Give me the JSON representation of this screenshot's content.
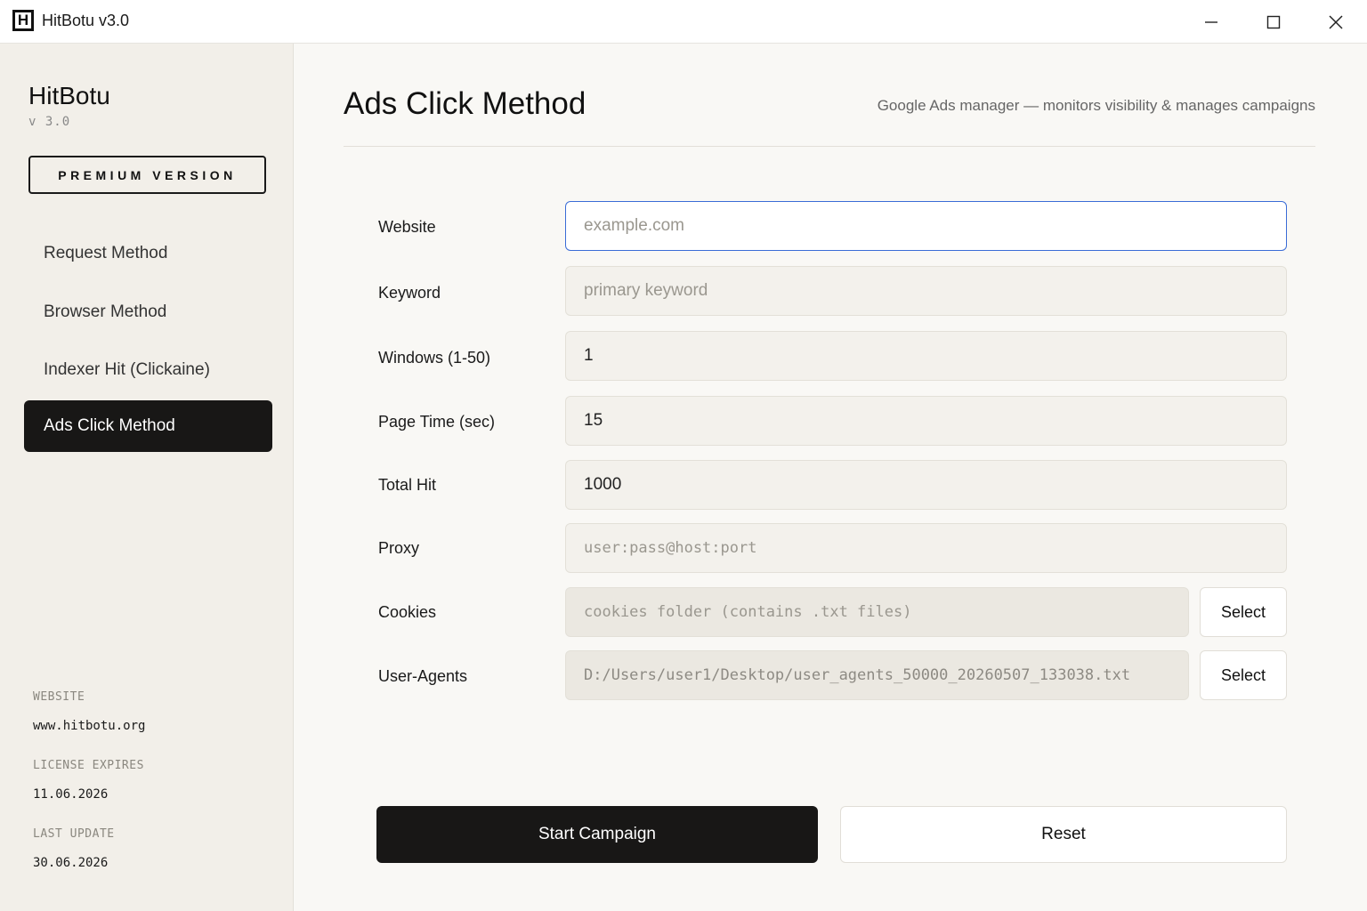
{
  "window": {
    "title": "HitBotu v3.0",
    "icon_letter": "H"
  },
  "sidebar": {
    "brand": "HitBotu",
    "version": "v 3.0",
    "premium_label": "PREMIUM VERSION",
    "items": [
      {
        "label": "Request Method",
        "active": false
      },
      {
        "label": "Browser Method",
        "active": false
      },
      {
        "label": "Indexer Hit (Clickaine)",
        "active": false
      },
      {
        "label": "Ads Click Method",
        "active": true
      }
    ],
    "meta": {
      "website_label": "WEBSITE",
      "website_value": "www.hitbotu.org",
      "license_label": "LICENSE EXPIRES",
      "license_value": "11.06.2026",
      "update_label": "LAST UPDATE",
      "update_value": "30.06.2026"
    }
  },
  "main": {
    "title": "Ads Click Method",
    "subtitle": "Google Ads manager — monitors visibility & manages campaigns",
    "fields": {
      "website": {
        "label": "Website",
        "value": "",
        "placeholder": "example.com"
      },
      "keyword": {
        "label": "Keyword",
        "value": "",
        "placeholder": "primary keyword"
      },
      "windows": {
        "label": "Windows (1-50)",
        "value": "1",
        "placeholder": ""
      },
      "page_time": {
        "label": "Page Time (sec)",
        "value": "15",
        "placeholder": ""
      },
      "total_hit": {
        "label": "Total Hit",
        "value": "1000",
        "placeholder": ""
      },
      "proxy": {
        "label": "Proxy",
        "value": "",
        "placeholder": "user:pass@host:port"
      },
      "cookies": {
        "label": "Cookies",
        "value": "",
        "placeholder": "cookies folder (contains .txt files)",
        "button": "Select"
      },
      "user_agents": {
        "label": "User-Agents",
        "value": "D:/Users/user1/Desktop/user_agents_50000_20260507_133038.txt",
        "placeholder": "",
        "button": "Select"
      }
    },
    "start_label": "Start Campaign",
    "reset_label": "Reset"
  },
  "colors": {
    "accent_focus": "#3a6cd6",
    "primary_dark": "#181716",
    "sidebar_bg": "#f2efe9"
  }
}
